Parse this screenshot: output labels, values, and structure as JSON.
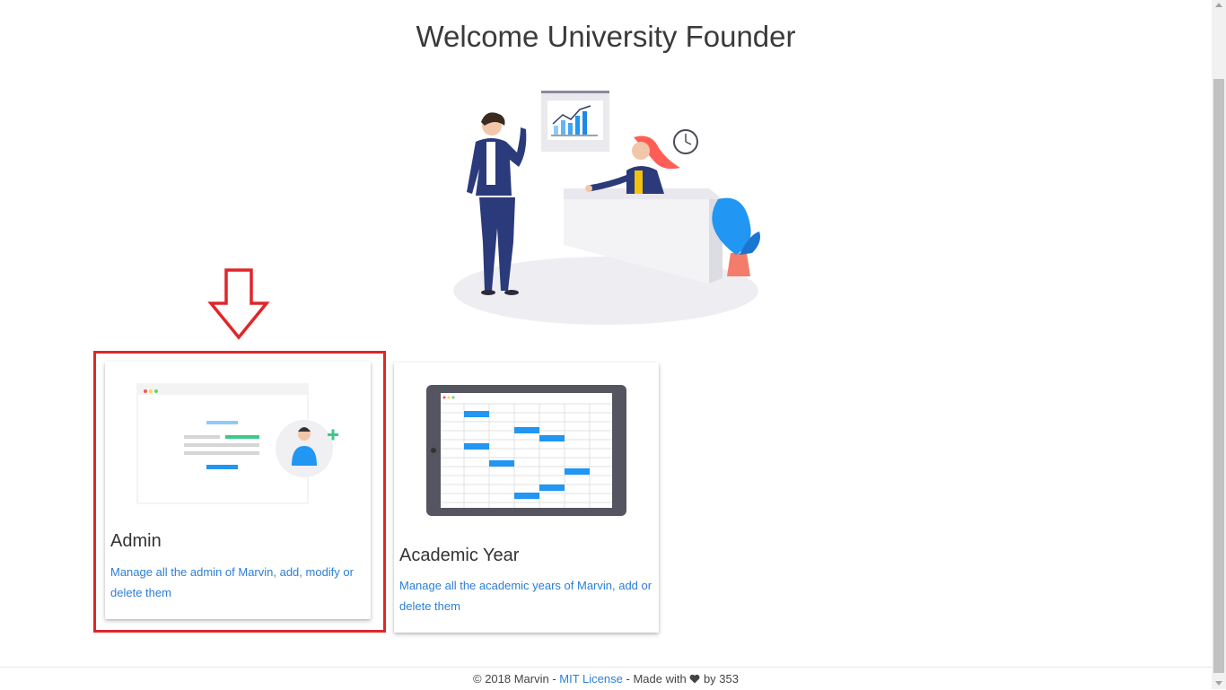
{
  "header": {
    "title": "Welcome University Founder"
  },
  "hero": {
    "illustration": "office-reception-illustration"
  },
  "cards": [
    {
      "title": "Admin",
      "description": "Manage all the admin of Marvin, add, modify or delete them",
      "illustration": "admin-add-user-illustration"
    },
    {
      "title": "Academic Year",
      "description": "Manage all the academic years of Marvin, add or delete them",
      "illustration": "calendar-tablet-illustration"
    }
  ],
  "annotation": {
    "highlight_color": "#e0262a",
    "arrow_icon": "down-arrow-icon"
  },
  "footer": {
    "copyright": "© 2018 Marvin -",
    "license_link": "MIT License",
    "made_with": "- Made with",
    "heart_icon": "heart-icon",
    "by": "by 353"
  },
  "colors": {
    "link": "#2b7fd6",
    "accent_blue": "#2196f3",
    "accent_green": "#3cc98a"
  }
}
